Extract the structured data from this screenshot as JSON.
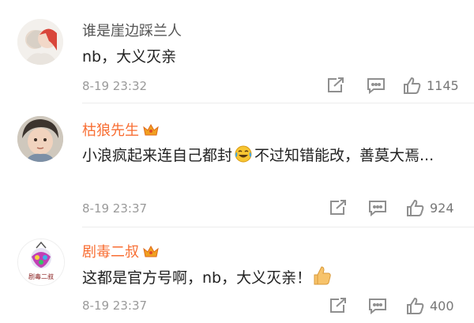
{
  "comments": [
    {
      "username": "谁是崖边踩兰人",
      "vip": false,
      "text": "nb，大义灭亲",
      "time": "8-19 23:32",
      "likes": "1145"
    },
    {
      "username": "枯狼先生",
      "vip": true,
      "text_before_emoji": "小浪疯起来连自己都封",
      "text_after_emoji": "不过知错能改，善莫大焉...",
      "time": "8-19 23:37",
      "likes": "924"
    },
    {
      "username": "剧毒二叔",
      "vip": true,
      "text": "这都是官方号啊，nb，大义灭亲！",
      "time": "8-19 23:37",
      "likes": "400",
      "avatar_text": "剧毒二叔"
    }
  ],
  "colors": {
    "vip_name": "#f86e33",
    "normal_name": "#555555",
    "meta": "#9a9a9a",
    "icon": "#8f8f8f"
  }
}
